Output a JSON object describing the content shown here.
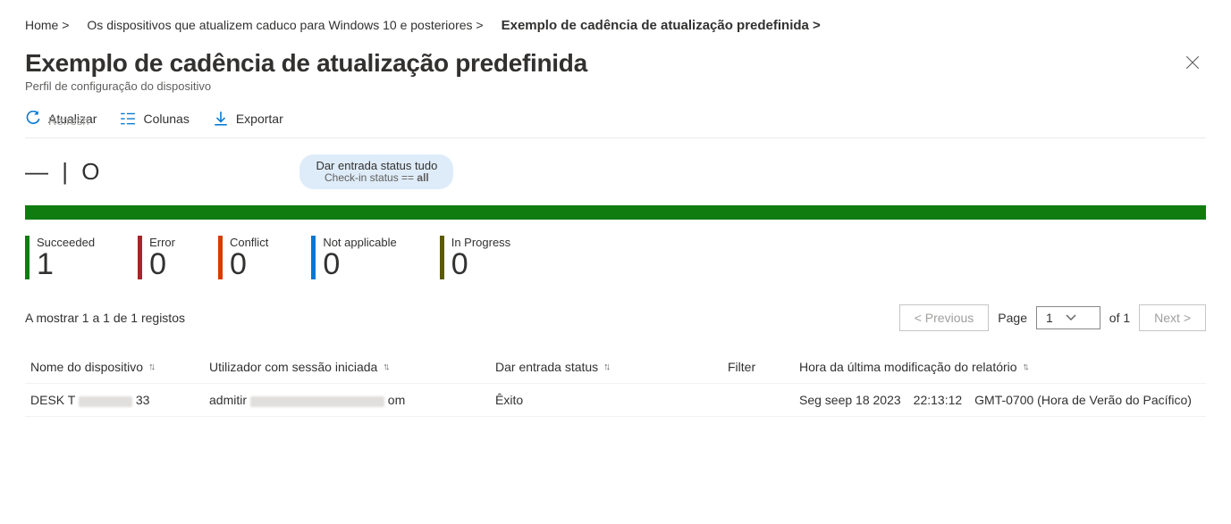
{
  "breadcrumb": {
    "home": "Home >",
    "devices": "Os dispositivos que atualizem caduco para Windows 10 e posteriores >",
    "current": "Exemplo de cadência de atualização predefinida >"
  },
  "header": {
    "title": "Exemplo de cadência de atualização predefinida",
    "subtitle": "Perfil de configuração do dispositivo"
  },
  "toolbar": {
    "refresh": "Atualizar",
    "refresh_ghost": "Refresh",
    "columns": "Colunas",
    "export": "Exportar"
  },
  "filter": {
    "collapsed_glyph": "— | O",
    "pill_top": "Dar entrada status tudo",
    "pill_bottom": "Check-in status == all"
  },
  "stats": {
    "succeeded": {
      "label": "Succeeded",
      "value": "1",
      "color": "#107c10"
    },
    "error": {
      "label": "Error",
      "value": "0",
      "color": "#a4262c"
    },
    "conflict": {
      "label": "Conflict",
      "value": "0",
      "color": "#d83b01"
    },
    "na": {
      "label": "Not applicable",
      "value": "0",
      "color": "#0078d4"
    },
    "progress": {
      "label": "In Progress",
      "value": "0",
      "color": "#5c5a00"
    }
  },
  "results": {
    "showing": "A mostrar 1 a 1 de 1 registos",
    "prev": "<  Previous",
    "next": "Next  >",
    "page_label": "Page",
    "page_value": "1",
    "of_label": "of 1"
  },
  "table": {
    "headers": {
      "device": "Nome do dispositivo",
      "user": "Utilizador com sessão iniciada",
      "status": "Dar entrada status",
      "filter": "Filter",
      "modified": "Hora da última modificação do relatório"
    },
    "rows": [
      {
        "device_prefix": "DESK T",
        "device_suffix": "33",
        "user_prefix": "admitir",
        "user_suffix": "om",
        "status": "Êxito",
        "filter": "",
        "date": "Seg seep 18 2023",
        "time": "22:13:12",
        "tz": "GMT-0700 (Hora de Verão do Pacífico)"
      }
    ]
  }
}
